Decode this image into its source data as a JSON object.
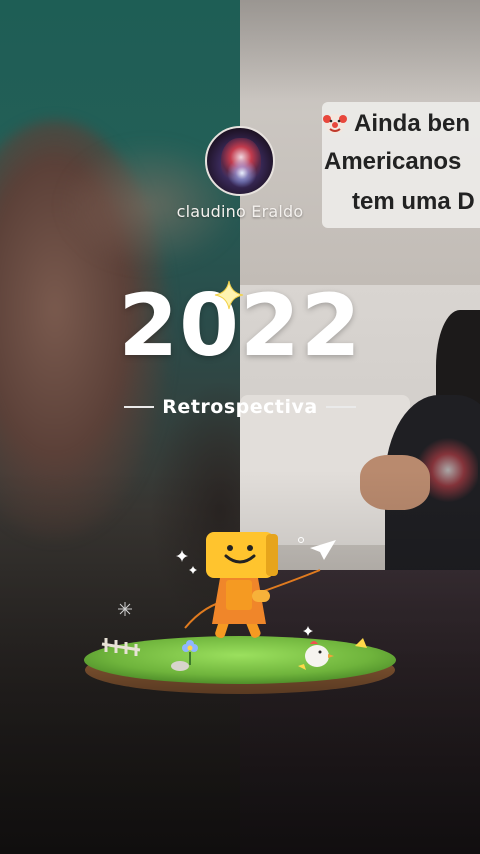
{
  "profile": {
    "username": "claudino Eraldo",
    "avatar": "avatar"
  },
  "title": {
    "year": "2022",
    "subtitle": "Retrospectiva"
  },
  "background_caption": {
    "lines": [
      "Ainda ben",
      "Americanos",
      "tem uma D"
    ],
    "emoji": "clown-face-icon"
  },
  "colors": {
    "left_panel": "#235f57",
    "text": "#ffffff",
    "character": "#f5a623",
    "grass": "#7fc84a"
  },
  "icons": {
    "sparkle": "sparkle-icon",
    "paper_plane": "paper-plane-icon",
    "mascot": "box-head-mascot"
  }
}
